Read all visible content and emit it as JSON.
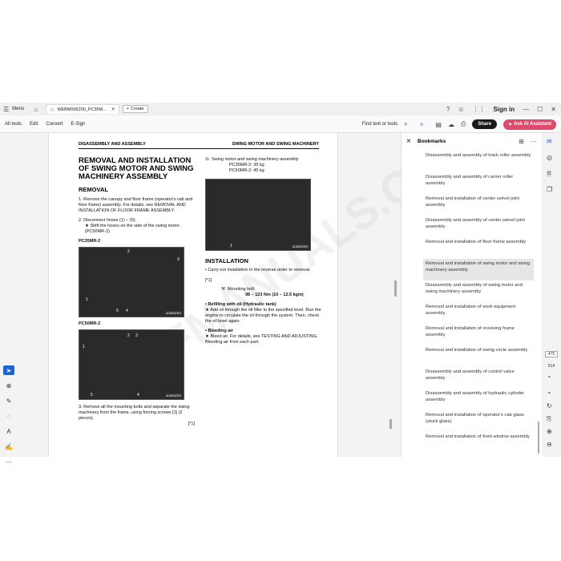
{
  "titlebar": {
    "menu_label": "Menu",
    "tab_title": "WEBM006200_PC35M...",
    "create_label": "Create",
    "signin_label": "Sign in"
  },
  "toolbar": {
    "items": [
      "All tools",
      "Edit",
      "Convert",
      "E-Sign"
    ],
    "find_label": "Find text or tools",
    "share_label": "Share",
    "ai_label": "Ask AI Assistant"
  },
  "document": {
    "header_left": "DISASSEMBLY AND ASSEMBLY",
    "header_right": "SWING MOTOR AND SWING MACHINERY",
    "title": "REMOVAL AND INSTALLATION OF SWING MOTOR AND SWING MACHINERY ASSEMBLY",
    "removal_heading": "REMOVAL",
    "step1": "1.   Remove the canopy and floor frame (operator's cab and floor frame) assembly.  For details, see REMOVAL AND INSTALLATION OF FLOOR FRAME ASSEMBLY.",
    "step2": "2.   Disconnect hoses (1) – (5).",
    "step2_note": "★  Shift the hoses on the side of the swing motor. (PC50MR-2)",
    "model1": "PC35MR-2",
    "model2": "PC50MR-2",
    "step3": "3.   Remove all the mounting bolts and separate the swing machinery from the frame, using forcing screws [1] (2 pieces).",
    "step3_ref": "[*1]",
    "fig1_code": "AJ0002SS",
    "fig2_code": "AJ0002SS",
    "fig3_code": "AJ0002SS",
    "weight_label": "Swing motor and swing machinery assembly",
    "weight1": "PC35MR-2: 35 kg",
    "weight2": "PC50MR-2: 45 kg",
    "install_heading": "INSTALLATION",
    "install_text": "•   Carry out installation in the reverse order to removal.",
    "install_ref": "[*1]",
    "bolt_label": "Mounting bolt:",
    "bolt_value": "98 – 123 Nm (10 – 12.5 kgm)",
    "refill_heading": "•   Refilling with oil (Hydraulic tank)",
    "refill_text": "★  Add oil through the oil filler to the specified level. Run the engine to circulate the oil through the system.  Then, check the oil level again.",
    "bleed_heading": "•   Bleeding air",
    "bleed_text": "★  Bleed air.  For details, see TESTING AND ADJUSTING, Bleeding air from each part."
  },
  "bookmarks": {
    "title": "Bookmarks",
    "items": [
      "Disassembly and assembly of track roller assembly",
      "Disassembly and assembly of carrier roller assembly",
      "Removal and installation of center swivel joint assembly",
      "Disassembly and assembly of center swivel joint assembly",
      "Removal and installation of floor frame assembly",
      "Removal and installation of swing motor and swing machinery assembly",
      "Disassembly and assembly of swing motor and swing machinery assembly",
      "Removal and installation of work equipment assembly",
      "Removal and installation of revolving frame assembly",
      "Removal and installation of swing circle assembly",
      "Disassembly and assembly of control valve assembly",
      "Disassembly and assembly of hydraulic cylinder assembly",
      "Removal and installation of operator's cab glass (stuck glass)",
      "Removal and installation of front window assembly"
    ],
    "selected_index": 5
  },
  "page_nav": {
    "current": "475",
    "total": "514"
  },
  "colors": {
    "accent": "#1c64d8",
    "ai_button": "#e04a6a",
    "share_button": "#1a1a1a"
  }
}
